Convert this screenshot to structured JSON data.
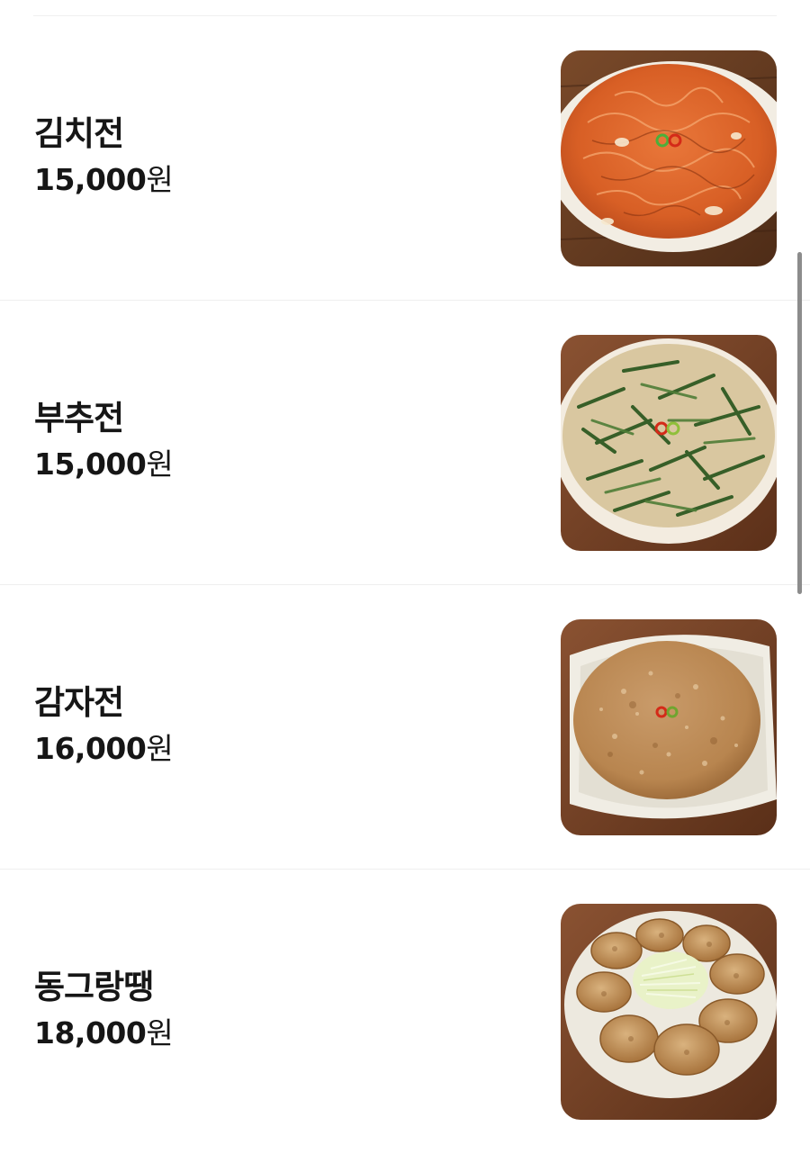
{
  "menu": {
    "items": [
      {
        "name": "김치전",
        "price": "15,000",
        "currency": "원",
        "image": "kimchi-pancake-photo"
      },
      {
        "name": "부추전",
        "price": "15,000",
        "currency": "원",
        "image": "chive-pancake-photo"
      },
      {
        "name": "감자전",
        "price": "16,000",
        "currency": "원",
        "image": "potato-pancake-photo"
      },
      {
        "name": "동그랑땡",
        "price": "18,000",
        "currency": "원",
        "image": "meat-patty-photo"
      }
    ]
  },
  "colors": {
    "text": "#161616",
    "divider": "#efefef",
    "scrollbar": "#8c8c8c",
    "table_wood": "#6b3e22",
    "plate": "#f3efe6"
  }
}
